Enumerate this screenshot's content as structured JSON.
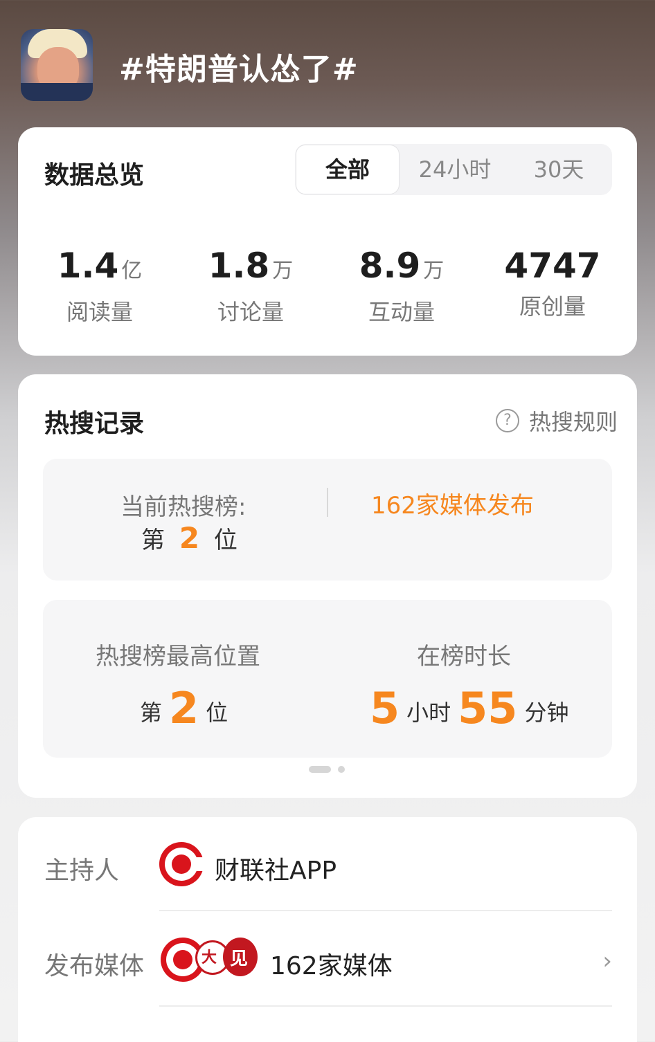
{
  "header": {
    "title": "#特朗普认怂了#"
  },
  "overview": {
    "title": "数据总览",
    "tabs": [
      "全部",
      "24小时",
      "30天"
    ],
    "active_tab": 0,
    "stats": [
      {
        "value": "1.4",
        "unit": "亿",
        "label": "阅读量"
      },
      {
        "value": "1.8",
        "unit": "万",
        "label": "讨论量"
      },
      {
        "value": "8.9",
        "unit": "万",
        "label": "互动量"
      },
      {
        "value": "4747",
        "unit": "",
        "label": "原创量"
      }
    ]
  },
  "hot_search": {
    "title": "热搜记录",
    "rules_label": "热搜规则",
    "rules_icon": "help-circle-icon",
    "current_label": "当前热搜榜:",
    "current_prefix": "第",
    "current_rank": "2",
    "current_suffix": "位",
    "media_publish": "162家媒体发布",
    "peak_label": "热搜榜最高位置",
    "peak_prefix": "第",
    "peak_rank": "2",
    "peak_suffix": "位",
    "duration_label": "在榜时长",
    "duration_hours": "5",
    "duration_hours_unit": "小时",
    "duration_minutes": "55",
    "duration_minutes_unit": "分钟"
  },
  "info": {
    "host_label": "主持人",
    "host_name": "财联社APP",
    "media_label": "发布媒体",
    "media_count": "162家媒体",
    "colors": {
      "accent": "#f6871f",
      "brand_red": "#d9141c"
    }
  }
}
